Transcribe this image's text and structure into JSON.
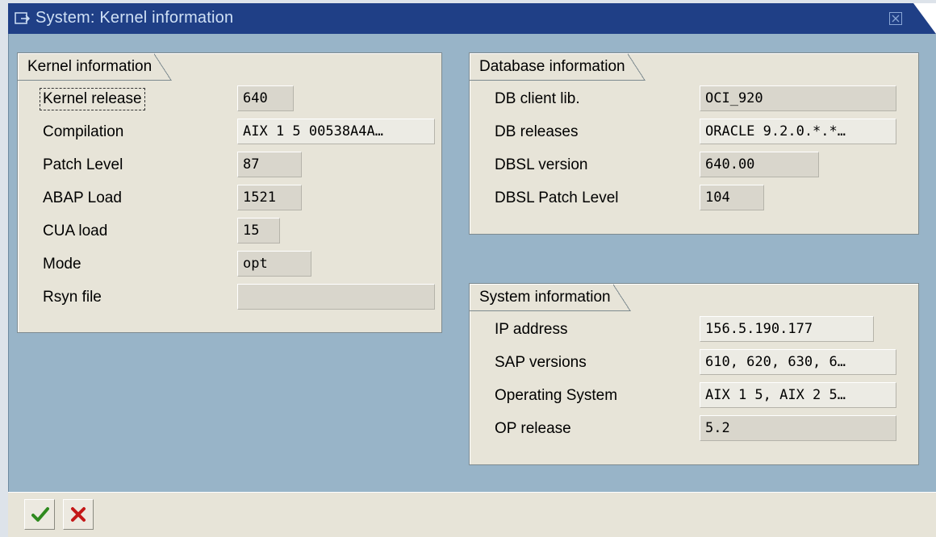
{
  "window": {
    "title": "System: Kernel information"
  },
  "kernel": {
    "heading": "Kernel information",
    "rows": [
      {
        "label": "Kernel release",
        "value": "640"
      },
      {
        "label": "Compilation",
        "value": "AIX 1 5 00538A4A…"
      },
      {
        "label": "Patch Level",
        "value": "87"
      },
      {
        "label": "ABAP Load",
        "value": "1521"
      },
      {
        "label": "CUA load",
        "value": "15"
      },
      {
        "label": "Mode",
        "value": "opt"
      },
      {
        "label": "Rsyn file",
        "value": ""
      }
    ]
  },
  "database": {
    "heading": "Database information",
    "rows": [
      {
        "label": "DB client lib.",
        "value": "OCI_920"
      },
      {
        "label": "DB releases",
        "value": "ORACLE 9.2.0.*.*…"
      },
      {
        "label": "DBSL version",
        "value": "640.00"
      },
      {
        "label": "DBSL Patch Level",
        "value": "104"
      }
    ]
  },
  "system": {
    "heading": "System information",
    "rows": [
      {
        "label": "IP address",
        "value": "156.5.190.177"
      },
      {
        "label": "SAP versions",
        "value": "610, 620, 630, 6…"
      },
      {
        "label": "Operating System",
        "value": "AIX 1 5, AIX 2 5…"
      },
      {
        "label": "OP release",
        "value": "5.2"
      }
    ]
  },
  "toolbar": {
    "confirm_icon": "checkmark-icon",
    "cancel_icon": "cancel-x-icon"
  },
  "colors": {
    "titlebar": "#1f3f86",
    "client_bg": "#98b4c8",
    "frame_bg": "#e7e4d8",
    "confirm": "#2f8a1f",
    "cancel": "#c41818"
  }
}
